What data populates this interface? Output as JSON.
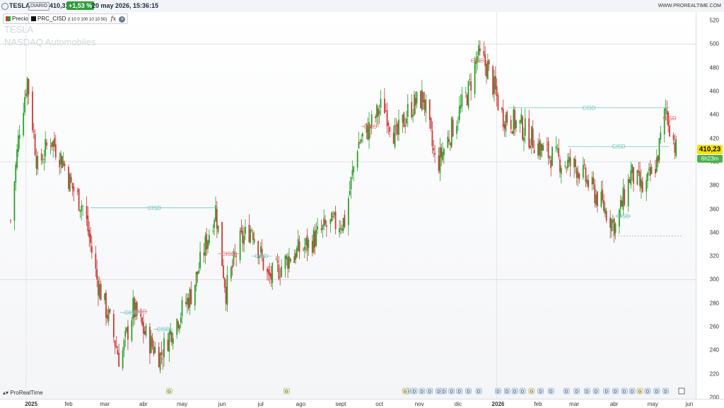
{
  "header": {
    "symbol": "TESLA",
    "period": "DIARIO",
    "price": "410,31",
    "change": "+1,53 %",
    "datetime": "20 may 2026, 15:36:15",
    "website": "WWW.PROREALTIME.COM"
  },
  "legend": {
    "price_label": "Precio",
    "indicator_label": "PRC_CISD",
    "indicator_params": "(t 10 0 100 10 10 50)",
    "fx_symbol": "fx"
  },
  "watermark": {
    "name": "TESLA",
    "subtitle": "NASDAQ  Automobiles"
  },
  "branding": "ProRealTime",
  "last_price_badge": "410,23",
  "countdown_badge": "6h23m",
  "event_marker_letter": "G",
  "event_marker_letter_2": "D",
  "colors": {
    "up": "#2ba02b",
    "down": "#cc3a3a",
    "cisd_bull": "#6fc7c2",
    "cisd_bear": "#ee7777",
    "price_badge": "#f6e200"
  },
  "chart_data": {
    "type": "candlestick",
    "title": "TESLA",
    "subtitle": "NASDAQ  Automobiles",
    "interval": "daily",
    "ylim": [
      200,
      520
    ],
    "y_ticks": [
      200,
      220,
      240,
      260,
      280,
      300,
      320,
      340,
      360,
      380,
      400,
      420,
      440,
      460,
      480,
      500,
      520
    ],
    "x_ticks": [
      "2025",
      "feb",
      "mar",
      "abr",
      "may",
      "jun",
      "jul",
      "ago",
      "sept",
      "oct",
      "nov",
      "dic",
      "2026",
      "feb",
      "mar",
      "abr",
      "may",
      "jun"
    ],
    "gridlines_y": [
      300,
      400,
      500
    ],
    "approx_closing_path": [
      {
        "date": "2024-12-20",
        "close": 350
      },
      {
        "date": "2024-12-27",
        "close": 430
      },
      {
        "date": "2025-01-02",
        "close": 470
      },
      {
        "date": "2025-01-10",
        "close": 395
      },
      {
        "date": "2025-01-20",
        "close": 420
      },
      {
        "date": "2025-01-30",
        "close": 400
      },
      {
        "date": "2025-02-05",
        "close": 380
      },
      {
        "date": "2025-02-15",
        "close": 360
      },
      {
        "date": "2025-02-25",
        "close": 300
      },
      {
        "date": "2025-03-08",
        "close": 260
      },
      {
        "date": "2025-03-15",
        "close": 230
      },
      {
        "date": "2025-03-25",
        "close": 275
      },
      {
        "date": "2025-04-05",
        "close": 250
      },
      {
        "date": "2025-04-15",
        "close": 235
      },
      {
        "date": "2025-04-25",
        "close": 260
      },
      {
        "date": "2025-05-10",
        "close": 290
      },
      {
        "date": "2025-05-28",
        "close": 360
      },
      {
        "date": "2025-06-05",
        "close": 290
      },
      {
        "date": "2025-06-15",
        "close": 330
      },
      {
        "date": "2025-06-25",
        "close": 345
      },
      {
        "date": "2025-07-08",
        "close": 300
      },
      {
        "date": "2025-07-25",
        "close": 320
      },
      {
        "date": "2025-08-08",
        "close": 330
      },
      {
        "date": "2025-08-22",
        "close": 345
      },
      {
        "date": "2025-09-05",
        "close": 350
      },
      {
        "date": "2025-09-15",
        "close": 415
      },
      {
        "date": "2025-09-25",
        "close": 430
      },
      {
        "date": "2025-10-05",
        "close": 450
      },
      {
        "date": "2025-10-15",
        "close": 420
      },
      {
        "date": "2025-10-25",
        "close": 445
      },
      {
        "date": "2025-11-05",
        "close": 455
      },
      {
        "date": "2025-11-15",
        "close": 395
      },
      {
        "date": "2025-11-28",
        "close": 430
      },
      {
        "date": "2025-12-10",
        "close": 460
      },
      {
        "date": "2025-12-17",
        "close": 490
      },
      {
        "date": "2025-12-25",
        "close": 480
      },
      {
        "date": "2026-01-05",
        "close": 440
      },
      {
        "date": "2026-01-20",
        "close": 430
      },
      {
        "date": "2026-02-05",
        "close": 410
      },
      {
        "date": "2026-02-20",
        "close": 400
      },
      {
        "date": "2026-03-05",
        "close": 395
      },
      {
        "date": "2026-03-20",
        "close": 370
      },
      {
        "date": "2026-04-03",
        "close": 345
      },
      {
        "date": "2026-04-15",
        "close": 390
      },
      {
        "date": "2026-04-25",
        "close": 375
      },
      {
        "date": "2026-05-05",
        "close": 400
      },
      {
        "date": "2026-05-12",
        "close": 445
      },
      {
        "date": "2026-05-20",
        "close": 410
      }
    ],
    "cisd_levels": [
      {
        "label": "CISD",
        "type": "bull",
        "price": 361,
        "from": "2025-02-20",
        "to": "2025-05-30"
      },
      {
        "label": "CISD",
        "type": "bear",
        "price": 322,
        "from": "2025-05-30",
        "to": "2025-06-15"
      },
      {
        "label": "CISD",
        "type": "bull",
        "price": 320,
        "from": "2025-06-25",
        "to": "2025-07-10"
      },
      {
        "label": "CISD",
        "type": "bull",
        "price": 272,
        "from": "2025-03-15",
        "to": "2025-04-01"
      },
      {
        "label": "CISD",
        "type": "bear",
        "price": 273,
        "from": "2025-03-25",
        "to": "2025-04-05"
      },
      {
        "label": "CISD",
        "type": "bull",
        "price": 258,
        "from": "2025-04-10",
        "to": "2025-04-25"
      },
      {
        "label": "CISD",
        "type": "bear",
        "price": 430,
        "from": "2025-09-18",
        "to": "2025-10-02"
      },
      {
        "label": "CISD",
        "type": "bear",
        "price": 486,
        "from": "2025-12-12",
        "to": "2025-12-22"
      },
      {
        "label": "CISD",
        "type": "bull",
        "price": 446,
        "from": "2026-01-10",
        "to": "2026-05-15"
      },
      {
        "label": "CISD",
        "type": "bull",
        "price": 413,
        "from": "2026-02-25",
        "to": "2026-05-15"
      },
      {
        "label": "CISD",
        "type": "bull",
        "price": 354,
        "from": "2026-04-03",
        "to": "2026-04-15"
      },
      {
        "label": "CISD",
        "type": "bear",
        "price": 437,
        "from": "2026-05-10",
        "to": "2026-05-20"
      }
    ],
    "support_level": {
      "price": 337,
      "from": "2026-04-05",
      "to": "2026-05-25"
    },
    "last_price": 410.23
  }
}
